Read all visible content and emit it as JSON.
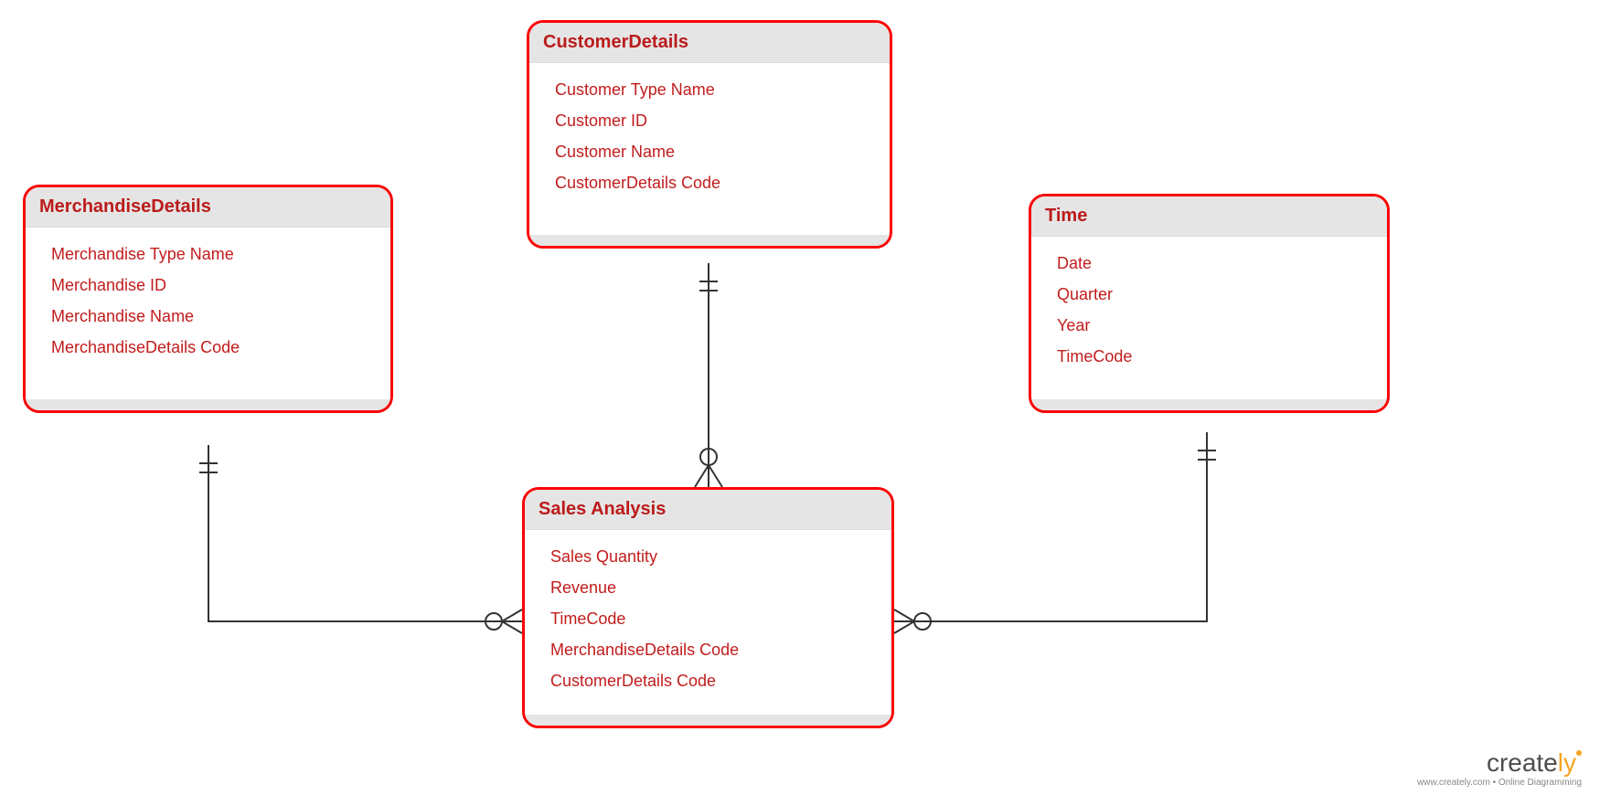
{
  "entities": {
    "merchandise": {
      "title": "MerchandiseDetails",
      "attrs": [
        "Merchandise Type Name",
        "Merchandise ID",
        "Merchandise Name",
        "MerchandiseDetails Code"
      ]
    },
    "customer": {
      "title": "CustomerDetails",
      "attrs": [
        "Customer Type Name",
        "Customer ID",
        "Customer Name",
        "CustomerDetails Code"
      ]
    },
    "time": {
      "title": "Time",
      "attrs": [
        "Date",
        "Quarter",
        "Year",
        "TimeCode"
      ]
    },
    "sales": {
      "title": "Sales Analysis",
      "attrs": [
        "Sales Quantity",
        "Revenue",
        "TimeCode",
        "MerchandiseDetails Code",
        "CustomerDetails Code"
      ]
    }
  },
  "watermark": {
    "brand_left": "create",
    "brand_right": "ly",
    "sub": "www.creately.com • Online Diagramming"
  }
}
